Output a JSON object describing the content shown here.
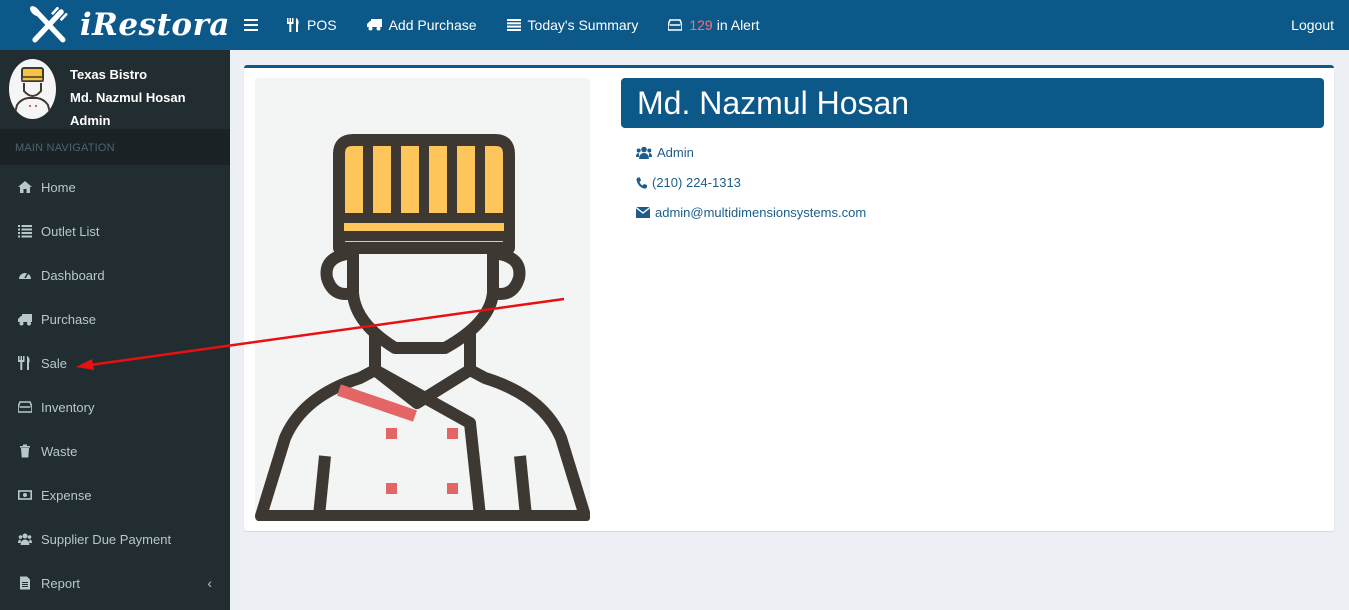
{
  "header": {
    "brand": "iRestora",
    "nav": {
      "pos": "POS",
      "add_purchase": "Add Purchase",
      "todays_summary": "Today's Summary",
      "alert_count": "129",
      "alert_label": "in Alert"
    },
    "logout": "Logout"
  },
  "user_panel": {
    "outlet": "Texas Bistro",
    "name": "Md. Nazmul Hosan",
    "role": "Admin"
  },
  "sidebar": {
    "section_title": "MAIN NAVIGATION",
    "items": [
      {
        "label": "Home",
        "icon": "home-icon"
      },
      {
        "label": "Outlet List",
        "icon": "list-icon"
      },
      {
        "label": "Dashboard",
        "icon": "dashboard-icon"
      },
      {
        "label": "Purchase",
        "icon": "truck-icon"
      },
      {
        "label": "Sale",
        "icon": "cutlery-icon"
      },
      {
        "label": "Inventory",
        "icon": "inbox-icon"
      },
      {
        "label": "Waste",
        "icon": "trash-icon"
      },
      {
        "label": "Expense",
        "icon": "money-icon"
      },
      {
        "label": "Supplier Due Payment",
        "icon": "users-icon"
      },
      {
        "label": "Report",
        "icon": "file-icon"
      }
    ],
    "report_chevron": "‹"
  },
  "profile": {
    "name": "Md. Nazmul Hosan",
    "role": "Admin",
    "phone": "(210) 224-1313",
    "email": "admin@multidimensionsystems.com"
  },
  "colors": {
    "header_bg": "#0c5889",
    "sidebar_bg": "#222d32",
    "content_bg": "#ecf0f5",
    "link": "#1c5d8a",
    "alert": "#ff6e6e",
    "annotation_arrow": "#e81010"
  }
}
